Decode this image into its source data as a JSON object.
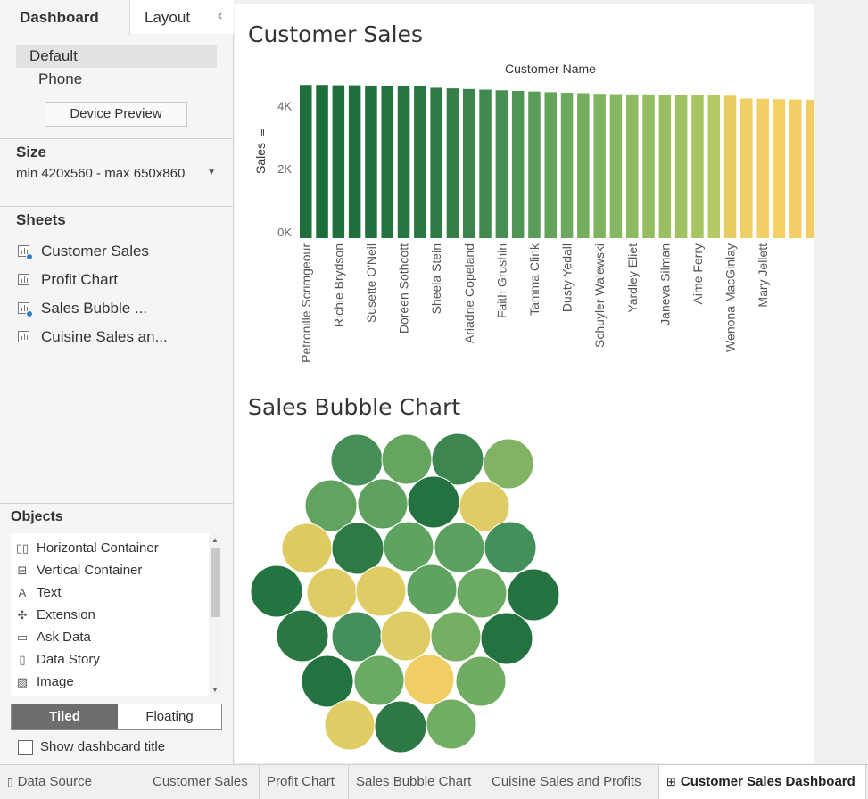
{
  "side_tabs": {
    "dashboard": "Dashboard",
    "layout": "Layout"
  },
  "device": {
    "default": "Default",
    "phone": "Phone",
    "preview_button": "Device Preview"
  },
  "size": {
    "title": "Size",
    "value": "min 420x560 - max 650x860"
  },
  "sheets": {
    "title": "Sheets",
    "items": [
      {
        "label": "Customer Sales",
        "used": true
      },
      {
        "label": "Profit Chart",
        "used": false
      },
      {
        "label": "Sales Bubble ...",
        "used": true
      },
      {
        "label": "Cuisine Sales an...",
        "used": false
      }
    ]
  },
  "objects": {
    "title": "Objects",
    "items": [
      {
        "label": "Horizontal Container",
        "icon": "horizontal-container-icon"
      },
      {
        "label": "Vertical Container",
        "icon": "vertical-container-icon"
      },
      {
        "label": "Text",
        "icon": "text-icon"
      },
      {
        "label": "Extension",
        "icon": "extension-icon"
      },
      {
        "label": "Ask Data",
        "icon": "ask-data-icon"
      },
      {
        "label": "Data Story",
        "icon": "data-story-icon"
      },
      {
        "label": "Image",
        "icon": "image-icon"
      }
    ],
    "tiled": "Tiled",
    "floating": "Floating",
    "show_title": "Show dashboard title"
  },
  "dashboard": {
    "title1": "Customer Sales",
    "title2": "Sales Bubble Chart"
  },
  "chart_data": [
    {
      "type": "bar",
      "title": "Customer Sales",
      "xlabel": "Customer Name",
      "ylabel": "Sales",
      "y_ticks": [
        "0K",
        "2K",
        "4K"
      ],
      "ylim": [
        0,
        4800
      ],
      "sorted": "descending",
      "categories": [
        "Petronille Scrimgeour",
        "",
        "Richie Brydson",
        "",
        "Susette O'Neil",
        "",
        "Doreen Sothcott",
        "",
        "Sheela Stein",
        "",
        "Ariadne Copeland",
        "",
        "Faith Grushin",
        "",
        "Tamma Clink",
        "",
        "Dusty Yedall",
        "",
        "Schuyler Walewski",
        "",
        "Yardley Eliet",
        "",
        "Janeva Silman",
        "",
        "Aime Ferry",
        "",
        "Wenona MacGinlay",
        "",
        "Mary Jellett",
        ""
      ],
      "values": [
        4850,
        4850,
        4840,
        4840,
        4830,
        4820,
        4810,
        4800,
        4760,
        4740,
        4720,
        4700,
        4680,
        4660,
        4640,
        4620,
        4600,
        4590,
        4570,
        4560,
        4550,
        4550,
        4540,
        4540,
        4530,
        4520,
        4510,
        4420,
        4410,
        4400,
        4390,
        4380
      ],
      "colors": [
        "#1e6e3c",
        "#1e6e3c",
        "#206f3d",
        "#20703e",
        "#22713e",
        "#24733f",
        "#277541",
        "#2a7743",
        "#2f7b45",
        "#357f48",
        "#3b854c",
        "#418a4f",
        "#489052",
        "#4f9555",
        "#599d57",
        "#63a45a",
        "#6ca95c",
        "#75ae5e",
        "#7fb360",
        "#86b761",
        "#8dba62",
        "#94bd62",
        "#9abf62",
        "#a0c162",
        "#a8c562",
        "#b5ca63",
        "#e8cc62",
        "#efce63",
        "#f2cf64",
        "#f4d065",
        "#f2cf64",
        "#f0ce63"
      ]
    },
    {
      "type": "bubble",
      "title": "Sales Bubble Chart",
      "bubble_colors": [
        "#478f58",
        "#65a55f",
        "#3d8650",
        "#82b365",
        "#62a360",
        "#5fa25f",
        "#237240",
        "#dfcc64",
        "#dfcb62",
        "#2f7945",
        "#5ea360",
        "#5aa05f",
        "#44905a",
        "#237441",
        "#dfcc64",
        "#dfcc64",
        "#5ea360",
        "#6aaa62",
        "#257340",
        "#2c7643",
        "#44905a",
        "#dfcc64",
        "#74af63",
        "#247240",
        "#237240",
        "#6aaa62",
        "#f1ce63",
        "#70ad63",
        "#dfcc64",
        "#2e7845",
        "#71ad63"
      ]
    }
  ],
  "bottom_tabs": {
    "data_source": "Data Source",
    "tabs": [
      "Customer Sales",
      "Profit Chart",
      "Sales Bubble Chart",
      "Cuisine Sales and Profits"
    ],
    "active": "Customer Sales Dashboard"
  }
}
